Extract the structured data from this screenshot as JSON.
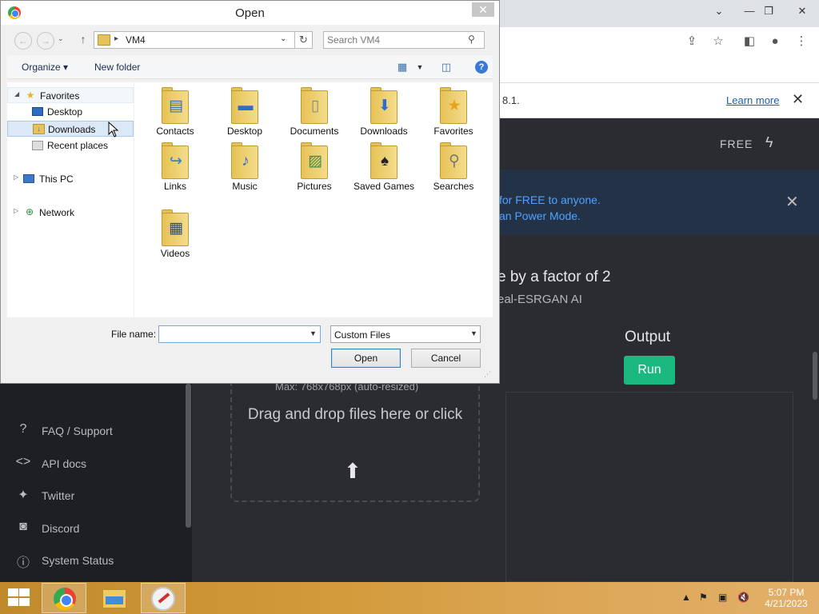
{
  "dialog": {
    "title": "Open",
    "address_path": "VM4",
    "search_placeholder": "Search VM4",
    "organize_label": "Organize ▾",
    "new_folder_label": "New folder",
    "nav_tree": [
      {
        "label": "Favorites"
      },
      {
        "label": "Desktop"
      },
      {
        "label": "Downloads"
      },
      {
        "label": "Recent places"
      },
      {
        "label": "This PC"
      },
      {
        "label": "Network"
      }
    ],
    "files": [
      {
        "name": "Contacts"
      },
      {
        "name": "Desktop"
      },
      {
        "name": "Documents"
      },
      {
        "name": "Downloads"
      },
      {
        "name": "Favorites"
      },
      {
        "name": "Links"
      },
      {
        "name": "Music"
      },
      {
        "name": "Pictures"
      },
      {
        "name": "Saved Games"
      },
      {
        "name": "Searches"
      },
      {
        "name": "Videos"
      }
    ],
    "file_name_label": "File name:",
    "file_name_value": "",
    "file_type_value": "Custom Files",
    "open_button": "Open",
    "cancel_button": "Cancel"
  },
  "browser": {
    "infobar_text": "8.1.",
    "learn_more": "Learn more",
    "header_free": "FREE",
    "banner_line1": "for FREE to anyone.",
    "banner_line2": "an Power Mode.",
    "heading": "e by a factor of 2",
    "subheading": "eal-ESRGAN AI",
    "output_label": "Output",
    "run_button": "Run",
    "dropzone_max": "Max: 768x768px (auto-resized)",
    "dropzone_text": "Drag and drop files here or click",
    "sidebar": [
      {
        "label": "FAQ / Support",
        "icon": "?"
      },
      {
        "label": "API docs",
        "icon": "<>"
      },
      {
        "label": "Twitter",
        "icon": "🐦"
      },
      {
        "label": "Discord",
        "icon": "◼"
      },
      {
        "label": "System Status",
        "icon": "ℹ"
      }
    ]
  },
  "taskbar": {
    "time": "5:07 PM",
    "date": "4/21/2023"
  }
}
